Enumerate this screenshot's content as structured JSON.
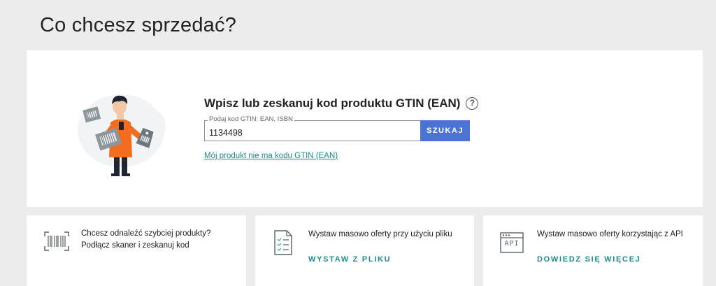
{
  "page": {
    "title": "Co chcesz sprzedać?"
  },
  "search": {
    "heading": "Wpisz lub zeskanuj kod produktu GTIN (EAN)",
    "help_glyph": "?",
    "field_label": "Podaj kod GTIN: EAN, ISBN",
    "value": "1134498",
    "button_label": "SZUKAJ",
    "no_code_link": "Mój produkt nie ma kodu GTIN (EAN)"
  },
  "tiles": [
    {
      "icon": "barcode-scanner-icon",
      "text_line1": "Chcesz odnaleźć szybciej produkty?",
      "text_line2": "Podłącz skaner i zeskanuj kod"
    },
    {
      "icon": "checklist-file-icon",
      "text": "Wystaw masowo oferty przy użyciu pliku",
      "action": "WYSTAW Z PLIKU"
    },
    {
      "icon": "api-window-icon",
      "text": "Wystaw masowo oferty korzystając z API",
      "icon_label": "API",
      "action": "DOWIEDZ SIĘ WIĘCEJ"
    }
  ],
  "colors": {
    "accent_button": "#4b73d3",
    "link": "#1f8a8a",
    "background": "#ececec",
    "illustration_orange": "#f26d1f"
  }
}
